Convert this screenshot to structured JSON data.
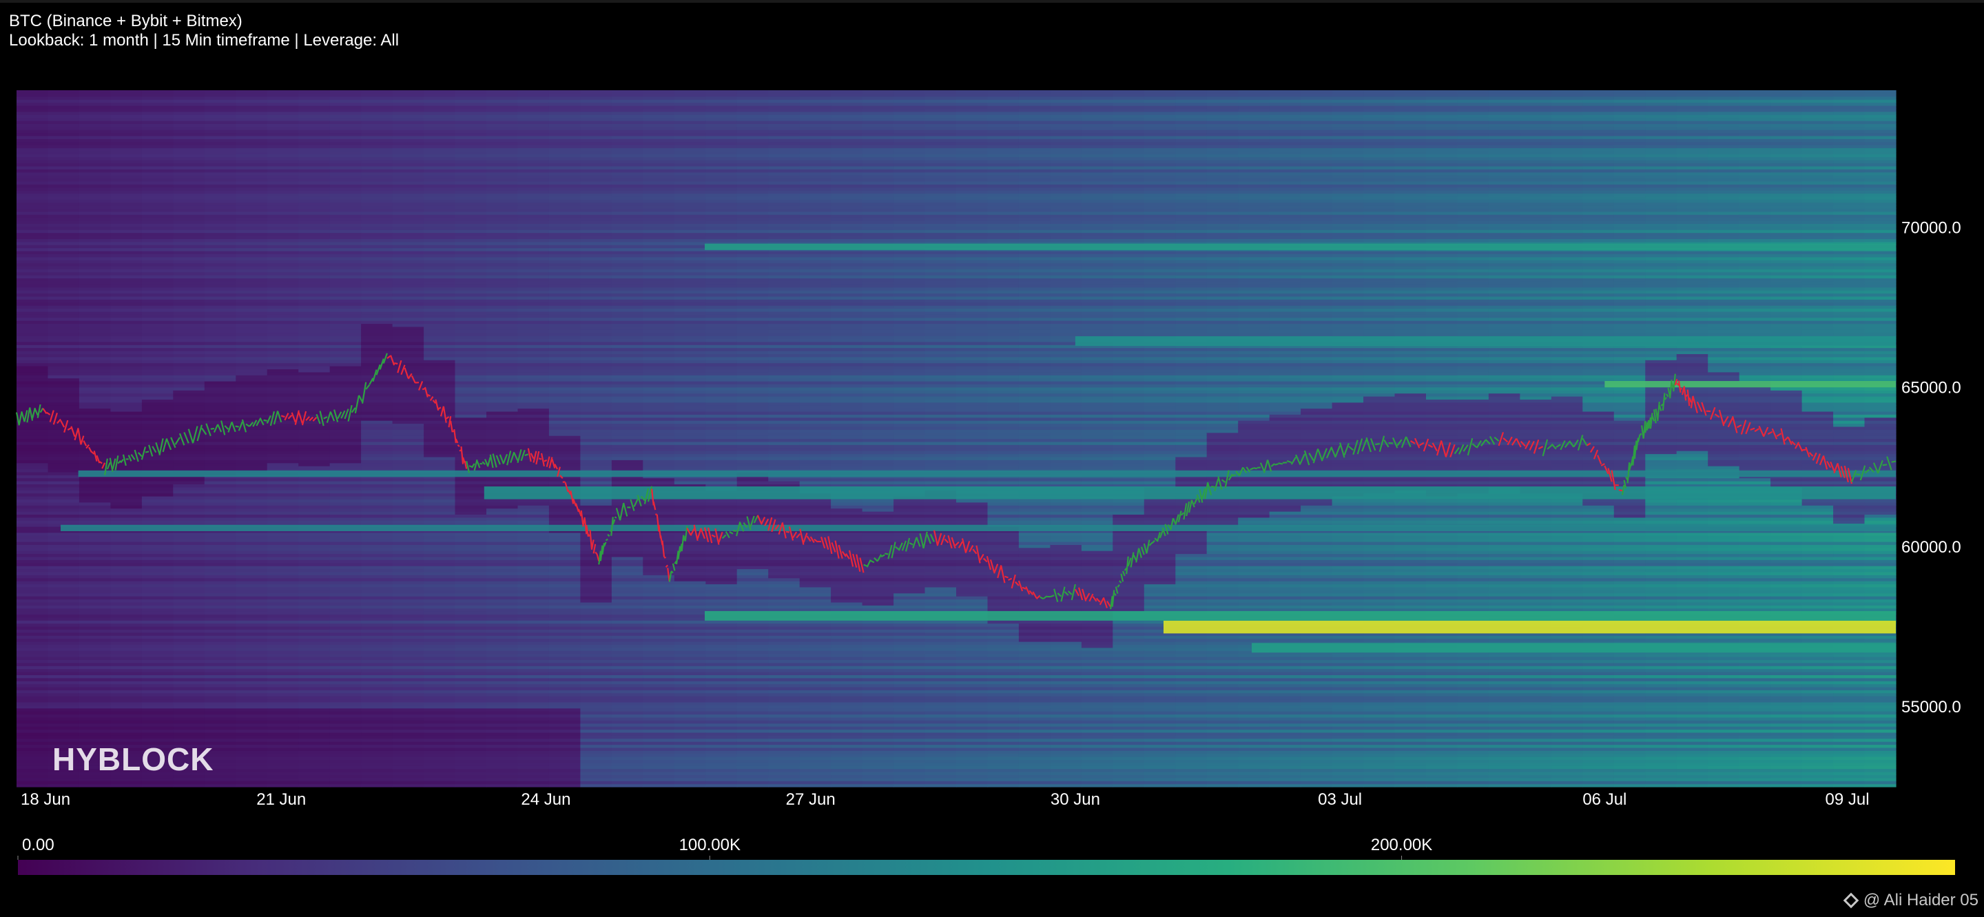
{
  "chart_data": {
    "type": "heatmap",
    "title": "BTC (Binance + Bybit + Bitmex)",
    "subtitle": "Lookback: 1 month | 15 Min timeframe | Leverage: All",
    "watermark": "HYBLOCK",
    "credit": "@ Ali Haider 05",
    "y_ticks": [
      "70000.0",
      "65000.0",
      "60000.0",
      "55000.0"
    ],
    "y_tick_values": [
      70000,
      65000,
      60000,
      55000
    ],
    "ylim": [
      52500,
      74300
    ],
    "x_ticks": [
      "18 Jun",
      "21 Jun",
      "24 Jun",
      "27 Jun",
      "30 Jun",
      "03 Jul",
      "06 Jul",
      "09 Jul"
    ],
    "x_tick_values": [
      0,
      3,
      6,
      9,
      12,
      15,
      18,
      21
    ],
    "xlim": [
      0,
      21.3
    ],
    "colorbar": {
      "labels": [
        "0.00",
        "100.00K",
        "200.00K"
      ],
      "label_values": [
        0,
        100000,
        200000
      ],
      "range": [
        0,
        280000
      ],
      "colors": [
        "#440154",
        "#472d7b",
        "#3b528b",
        "#2c728e",
        "#21918c",
        "#28ae80",
        "#5ec962",
        "#addc30",
        "#fde725"
      ]
    },
    "price_series": {
      "name": "BTC price",
      "x": [
        0,
        0.3,
        0.7,
        1.0,
        1.3,
        1.7,
        2.2,
        2.6,
        3.0,
        3.4,
        3.8,
        4.2,
        4.6,
        4.9,
        5.1,
        5.4,
        5.8,
        6.1,
        6.4,
        6.6,
        6.8,
        7.2,
        7.4,
        7.6,
        8.0,
        8.4,
        8.8,
        9.2,
        9.6,
        10.0,
        10.4,
        10.8,
        11.2,
        11.6,
        12.0,
        12.4,
        12.6,
        12.9,
        13.2,
        13.5,
        13.9,
        14.3,
        14.8,
        15.3,
        15.8,
        16.3,
        16.8,
        17.3,
        17.8,
        18.2,
        18.4,
        18.6,
        18.8,
        19.0,
        19.5,
        20.0,
        20.4,
        20.8,
        21.3
      ],
      "y": [
        64000,
        64300,
        63500,
        62500,
        62800,
        63200,
        63700,
        63800,
        64100,
        64000,
        64200,
        66000,
        65000,
        64000,
        62500,
        62700,
        62900,
        62600,
        61000,
        59600,
        61000,
        61700,
        59000,
        60500,
        60300,
        60900,
        60400,
        60100,
        59400,
        60000,
        60300,
        60000,
        59100,
        58400,
        58600,
        58200,
        59500,
        60200,
        61000,
        61800,
        62400,
        62600,
        62900,
        63200,
        63300,
        63000,
        63400,
        63100,
        63300,
        61700,
        63500,
        64200,
        65200,
        64500,
        63800,
        63500,
        62800,
        62200,
        62700
      ],
      "colors": {
        "up": "#2ea043",
        "down": "#e8273a"
      }
    },
    "bands": [
      {
        "y_from": 57300,
        "y_to": 57700,
        "intensity": 0.95,
        "x_from": 13.0
      },
      {
        "y_from": 57700,
        "y_to": 58000,
        "intensity": 0.6,
        "x_from": 7.8
      },
      {
        "y_from": 56700,
        "y_to": 57000,
        "intensity": 0.55,
        "x_from": 14.0
      },
      {
        "y_from": 65000,
        "y_to": 65200,
        "intensity": 0.7,
        "x_from": 18.0
      },
      {
        "y_from": 69300,
        "y_to": 69500,
        "intensity": 0.55,
        "x_from": 7.8
      },
      {
        "y_from": 61500,
        "y_to": 61900,
        "intensity": 0.5,
        "x_from": 5.3
      },
      {
        "y_from": 62200,
        "y_to": 62400,
        "intensity": 0.45,
        "x_from": 0.7
      },
      {
        "y_from": 60500,
        "y_to": 60700,
        "intensity": 0.45,
        "x_from": 0.5
      },
      {
        "y_from": 66300,
        "y_to": 66600,
        "intensity": 0.5,
        "x_from": 12.0
      }
    ]
  }
}
